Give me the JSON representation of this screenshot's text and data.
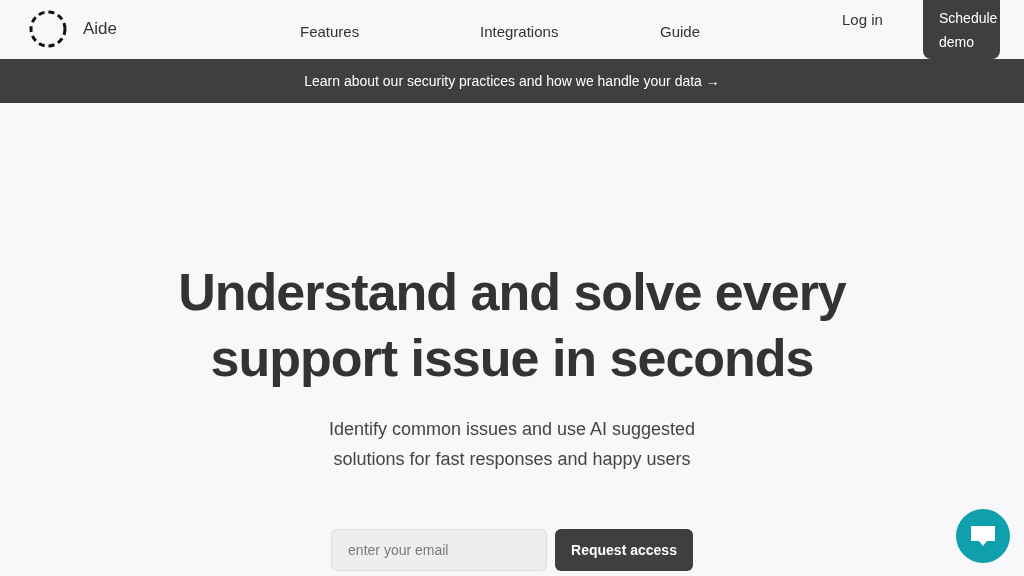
{
  "header": {
    "brand": "Aide",
    "nav": [
      "Features",
      "Integrations",
      "Guide"
    ],
    "login": "Log in",
    "cta": "Schedule demo"
  },
  "banner": {
    "text": "Learn about our security practices and how we handle your data →"
  },
  "hero": {
    "title": "Understand and solve every support issue in seconds",
    "subtitle": "Identify common issues and use AI suggested solutions for fast responses and happy users",
    "email": {
      "placeholder": "enter your email"
    },
    "button": "Request access"
  }
}
